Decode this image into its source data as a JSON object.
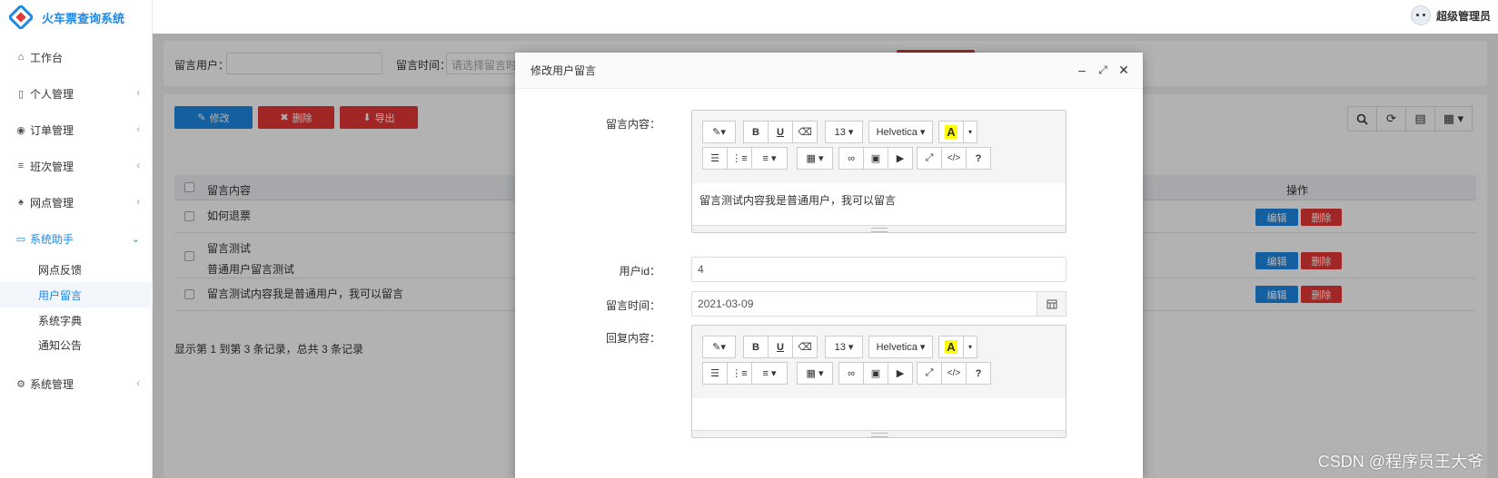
{
  "app": {
    "title": "火车票查询系统"
  },
  "user": {
    "name": "超级管理员"
  },
  "sidebar": {
    "items": [
      {
        "label": "工作台",
        "icon": "home-icon"
      },
      {
        "label": "个人管理",
        "icon": "id-card-icon"
      },
      {
        "label": "订单管理",
        "icon": "lightbulb-icon"
      },
      {
        "label": "班次管理",
        "icon": "bars-icon"
      },
      {
        "label": "网点管理",
        "icon": "bell-icon"
      },
      {
        "label": "系统助手",
        "icon": "laptop-icon"
      },
      {
        "label": "系统管理",
        "icon": "gear-icon"
      }
    ],
    "subitems": [
      "网点反馈",
      "用户留言",
      "系统字典",
      "通知公告"
    ]
  },
  "search": {
    "user_label": "留言用户：",
    "time_label": "留言时间：",
    "time_placeholder": "请选择留言时"
  },
  "toolbar": {
    "edit": "修改",
    "delete": "删除",
    "export": "导出"
  },
  "table": {
    "headers": {
      "content": "留言内容",
      "actions": "操作"
    },
    "rows": [
      {
        "lines": [
          "如何退票"
        ]
      },
      {
        "lines": [
          "留言测试",
          "普通用户留言测试"
        ]
      },
      {
        "lines": [
          "留言测试内容我是普通用户，我可以留言"
        ]
      }
    ],
    "row_edit": "编辑",
    "row_delete": "删除",
    "footer": "显示第 1 到第 3 条记录，总共 3 条记录"
  },
  "modal": {
    "title": "修改用户留言",
    "content_label": "留言内容：",
    "content_value": "留言测试内容我是普通用户，我可以留言",
    "userid_label": "用户id：",
    "userid_value": "4",
    "time_label": "留言时间：",
    "time_value": "2021-03-09",
    "reply_label": "回复内容：",
    "editor": {
      "font_size": "13",
      "font_name": "Helvetica",
      "color_btn": "A",
      "help": "?",
      "code": "</>",
      "bold": "B",
      "underline": "U"
    }
  },
  "watermark": "CSDN @程序员王大爷",
  "colors": {
    "primary": "#1e88e5",
    "danger": "#e53935"
  }
}
